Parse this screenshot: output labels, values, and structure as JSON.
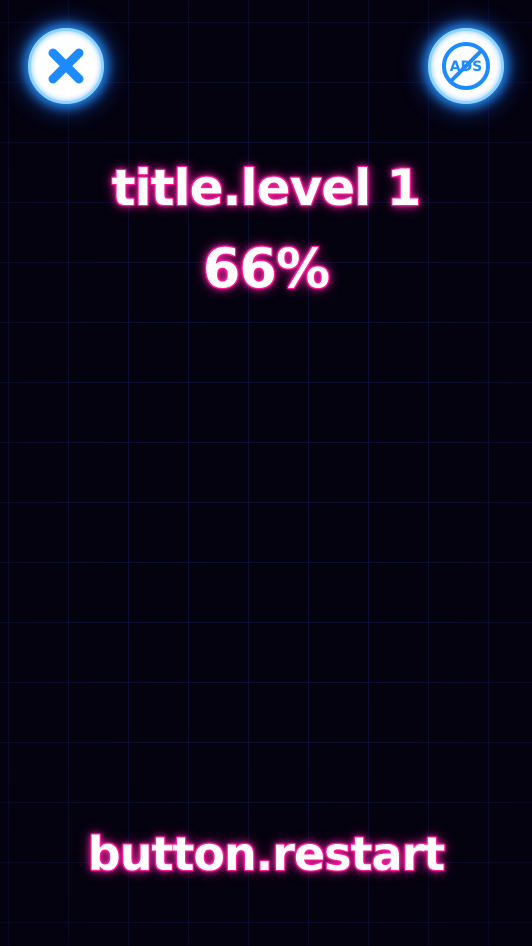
{
  "header": {
    "close_icon": "close-x-icon",
    "no_ads_icon": "no-ads-icon",
    "no_ads_icon_text": "ADS"
  },
  "level": {
    "title": "title.level 1",
    "progress_label": "66%",
    "progress_value": 66
  },
  "footer": {
    "restart_label": "button.restart"
  },
  "colors": {
    "background": "#04020f",
    "grid_line": "#1c2a6e",
    "button_fill": "#ffffff",
    "button_accent": "#1c8bff",
    "text_fill": "#ffffff",
    "text_glow": "#ff1a9c"
  }
}
